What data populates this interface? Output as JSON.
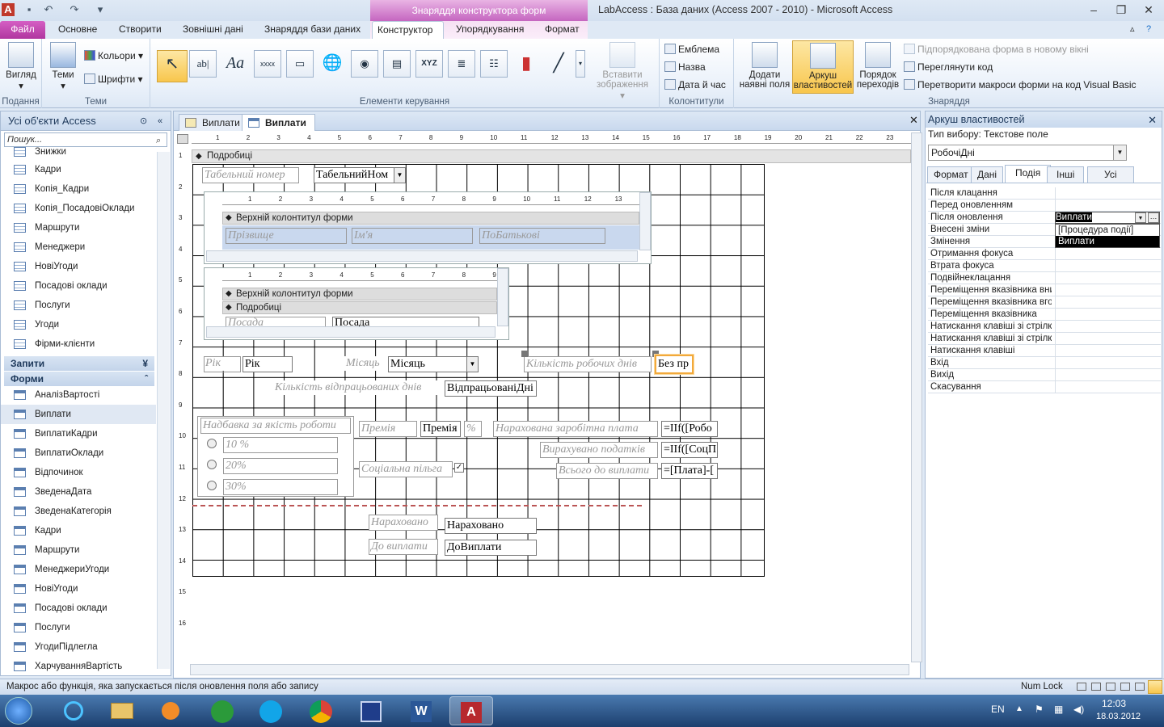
{
  "titlebar": {
    "context_title": "Знаряддя конструктора форм",
    "window_title": "LabAccess : База даних (Access 2007 - 2010)  -  Microsoft Access"
  },
  "ribbon_tabs": [
    "Файл",
    "Основне",
    "Створити",
    "Зовнішні дані",
    "Знаряддя бази даних",
    "Конструктор",
    "Упорядкування",
    "Формат"
  ],
  "ribbon": {
    "views": {
      "btn": "Вигляд",
      "group": "Подання"
    },
    "themes": {
      "btn": "Теми",
      "colors": "Кольори",
      "fonts": "Шрифти",
      "group": "Теми"
    },
    "controls": {
      "group": "Елементи керування",
      "insert_image": "Вставити зображення"
    },
    "header_footer": {
      "logo": "Емблема",
      "title": "Назва",
      "datetime": "Дата й час",
      "group": "Колонтитули"
    },
    "tools": {
      "add_fields": "Додати наявні поля",
      "property_sheet": "Аркуш властивостей",
      "tab_order": "Порядок переходів",
      "subform_new_window": "Підпорядкована форма в новому вікні",
      "view_code": "Переглянути код",
      "convert_macros": "Перетворити макроси форми на код Visual Basic",
      "group": "Знаряддя"
    }
  },
  "nav": {
    "title": "Усі об'єкти Access",
    "search_placeholder": "Пошук...",
    "top_items": [
      "Знижки",
      "Кадри",
      "Копія_Кадри",
      "Копія_ПосадовіОклади",
      "Маршрути",
      "Менеджери",
      "НовіУгоди",
      "Посадові оклади",
      "Послуги",
      "Угоди",
      "Фірми-клієнти"
    ],
    "group_queries": "Запити",
    "group_forms": "Форми",
    "forms": [
      "АналізВартості",
      "Виплати",
      "ВиплатиКадри",
      "ВиплатиОклади",
      "Відпочинок",
      "ЗведенаДата",
      "ЗведенаКатегорія",
      "Кадри",
      "Маршрути",
      "МенеджериУгоди",
      "НовіУгоди",
      "Посадові оклади",
      "Послуги",
      "УгодиПідлегла",
      "ХарчуванняВартість"
    ]
  },
  "doc": {
    "tabs": [
      "Виплати",
      "Виплати"
    ],
    "section_detail": "Подробиці",
    "ruler_h": [
      "1",
      "2",
      "3",
      "4",
      "5",
      "6",
      "7",
      "8",
      "9",
      "10",
      "11",
      "12",
      "13",
      "14",
      "15",
      "16",
      "17",
      "18",
      "19",
      "20",
      "21",
      "22",
      "23"
    ],
    "ruler_v": [
      "1",
      "2",
      "3",
      "4",
      "5",
      "6",
      "7",
      "8",
      "9",
      "10",
      "11",
      "12",
      "13",
      "14",
      "15",
      "16"
    ],
    "sub_ruler1": [
      "1",
      "2",
      "3",
      "4",
      "5",
      "6",
      "7",
      "8",
      "9",
      "10",
      "11",
      "12",
      "13"
    ],
    "sub_ruler2": [
      "1",
      "2",
      "3",
      "4",
      "5",
      "6",
      "7",
      "8",
      "9"
    ],
    "form": {
      "tab_num_label": "Табельний номер",
      "tab_num_value": "ТабельнийНом",
      "sub1_header": "Верхній колонтитул форми",
      "sub1_surname": "Прізвище",
      "sub1_name": "Ім'я",
      "sub1_patronymic": "ПоБатькові",
      "sub2_header": "Верхній колонтитул форми",
      "sub2_detail": "Подробиці",
      "sub2_pos_label": "Посада",
      "sub2_pos_value": "Посада",
      "year_label": "Рік",
      "year_value": "Рік",
      "month_label": "Місяць",
      "month_value": "Місяць",
      "workdays_label": "Кількість робочих днів",
      "workdays_value": "Без пр",
      "worked_label": "Кількість відпрацьованих днів",
      "worked_value": "ВідпрацьованіДні",
      "quality_label": "Надбавка за якість роботи",
      "opt1": "10 %",
      "opt2": "20%",
      "opt3": "30%",
      "bonus_label": "Премія",
      "bonus_value": "Премія",
      "percent": "%",
      "social_label": "Соціальна пільга",
      "accrued_salary_label": "Нарахована заробітна плата",
      "accrued_salary_value": "=IIf([Робо",
      "tax_label": "Вирахувано податків",
      "tax_value": "=IIf([СоцП",
      "total_label": "Всього до виплати",
      "total_value": "=[Плата]-[",
      "accrued_label": "Нараховано",
      "accrued_value": "Нараховано",
      "topay_label": "До виплати",
      "topay_value": "ДоВиплати"
    }
  },
  "props": {
    "title": "Аркуш властивостей",
    "selection_type": "Тип вибору:  Текстове поле",
    "object": "РобочіДні",
    "tabs": [
      "Формат",
      "Дані",
      "Подія",
      "Інші",
      "Усі"
    ],
    "rows": [
      "Після клацання",
      "Перед оновленням",
      "Після оновлення",
      "Внесені зміни",
      "Змінення",
      "Отримання фокуса",
      "Втрата фокуса",
      "Подвійнеклацання",
      "Переміщення вказівника вни",
      "Переміщення вказівника вго",
      "Переміщення вказівника",
      "Натискання клавіші зі стрілк",
      "Натискання клавіші зі стрілк",
      "Натискання клавіші",
      "Вхід",
      "Вихід",
      "Скасування"
    ],
    "after_update_value": "Виплати",
    "dropdown": [
      "[Процедура події]",
      "Виплати"
    ]
  },
  "status": {
    "text": "Макрос або функція, яка запускається після оновлення поля або запису",
    "numlock": "Num Lock"
  },
  "taskbar": {
    "lang": "EN",
    "time": "12:03",
    "date": "18.03.2012"
  }
}
